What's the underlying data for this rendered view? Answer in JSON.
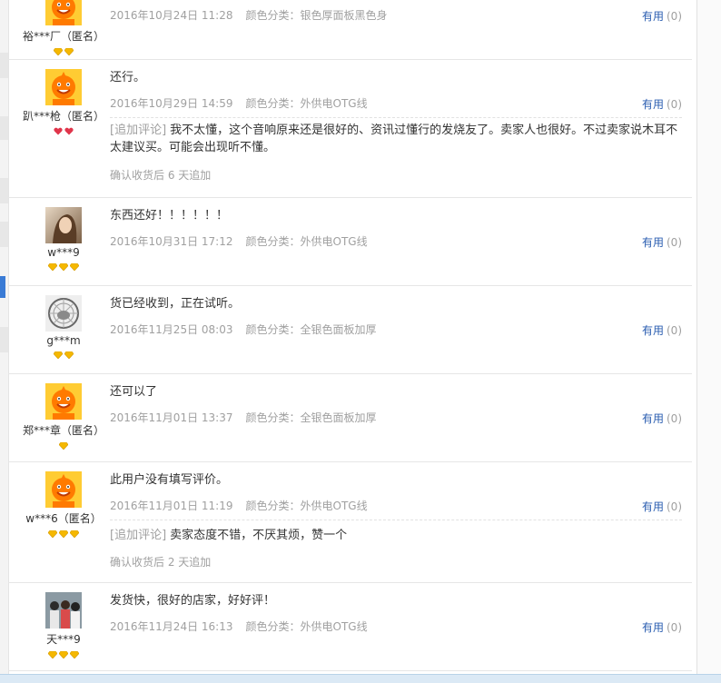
{
  "reviews": [
    {
      "username": "裕***厂（匿名）",
      "text": "",
      "date": "2016年10月24日 11:28",
      "sku_label": "颜色分类：",
      "sku_value": "银色厚面板黑色身",
      "useful_label": "有用",
      "useful_count": "(0)",
      "avatar": "taobao-mascot",
      "badge_type": "diamond-gold",
      "badge_count": 2
    },
    {
      "username": "趴***枪（匿名）",
      "text": "还行。",
      "date": "2016年10月29日 14:59",
      "sku_label": "颜色分类：",
      "sku_value": "外供电OTG线",
      "useful_label": "有用",
      "useful_count": "(0)",
      "append_tag": "[追加评论]",
      "append_text": "我不太懂，这个音响原来还是很好的、资讯过懂行的发烧友了。卖家人也很好。不过卖家说木耳不太建议买。可能会出现听不懂。",
      "append_note": "确认收货后 6 天追加",
      "avatar": "taobao-mascot",
      "badge_type": "heart-red",
      "badge_count": 2
    },
    {
      "username": "w***9",
      "text": "东西还好！！！！！！",
      "date": "2016年10月31日 17:12",
      "sku_label": "颜色分类：",
      "sku_value": "外供电OTG线",
      "useful_label": "有用",
      "useful_count": "(0)",
      "avatar": "photo-girl",
      "badge_type": "diamond-gold",
      "badge_count": 3
    },
    {
      "username": "g***m",
      "text": "货已经收到，正在试听。",
      "date": "2016年11月25日 08:03",
      "sku_label": "颜色分类：",
      "sku_value": "全银色面板加厚",
      "useful_label": "有用",
      "useful_count": "(0)",
      "avatar": "photo-hamster",
      "badge_type": "diamond-gold",
      "badge_count": 2
    },
    {
      "username": "郑***章（匿名）",
      "text": "还可以了",
      "date": "2016年11月01日 13:37",
      "sku_label": "颜色分类：",
      "sku_value": "全银色面板加厚",
      "useful_label": "有用",
      "useful_count": "(0)",
      "avatar": "taobao-mascot",
      "badge_type": "diamond-gold",
      "badge_count": 1
    },
    {
      "username": "w***6（匿名）",
      "text": "此用户没有填写评价。",
      "date": "2016年11月01日 11:19",
      "sku_label": "颜色分类：",
      "sku_value": "外供电OTG线",
      "useful_label": "有用",
      "useful_count": "(0)",
      "append_tag": "[追加评论]",
      "append_text": "卖家态度不错，不厌其烦，赞一个",
      "append_note": "确认收货后 2 天追加",
      "avatar": "taobao-mascot",
      "badge_type": "diamond-gold",
      "badge_count": 3
    },
    {
      "username": "天***9",
      "text": "发货快，很好的店家，好好评！",
      "date": "2016年11月24日 16:13",
      "sku_label": "颜色分类：",
      "sku_value": "外供电OTG线",
      "useful_label": "有用",
      "useful_count": "(0)",
      "avatar": "photo-group",
      "badge_type": "diamond-gold",
      "badge_count": 3
    }
  ],
  "colors": {
    "useful_link": "#2a5db0",
    "meta_text": "#a0a0a0",
    "badge_gold": "#f5b800",
    "badge_red": "#e0354b",
    "mascot_orange": "#ff7a00",
    "mascot_bg": "#ffcc33"
  }
}
